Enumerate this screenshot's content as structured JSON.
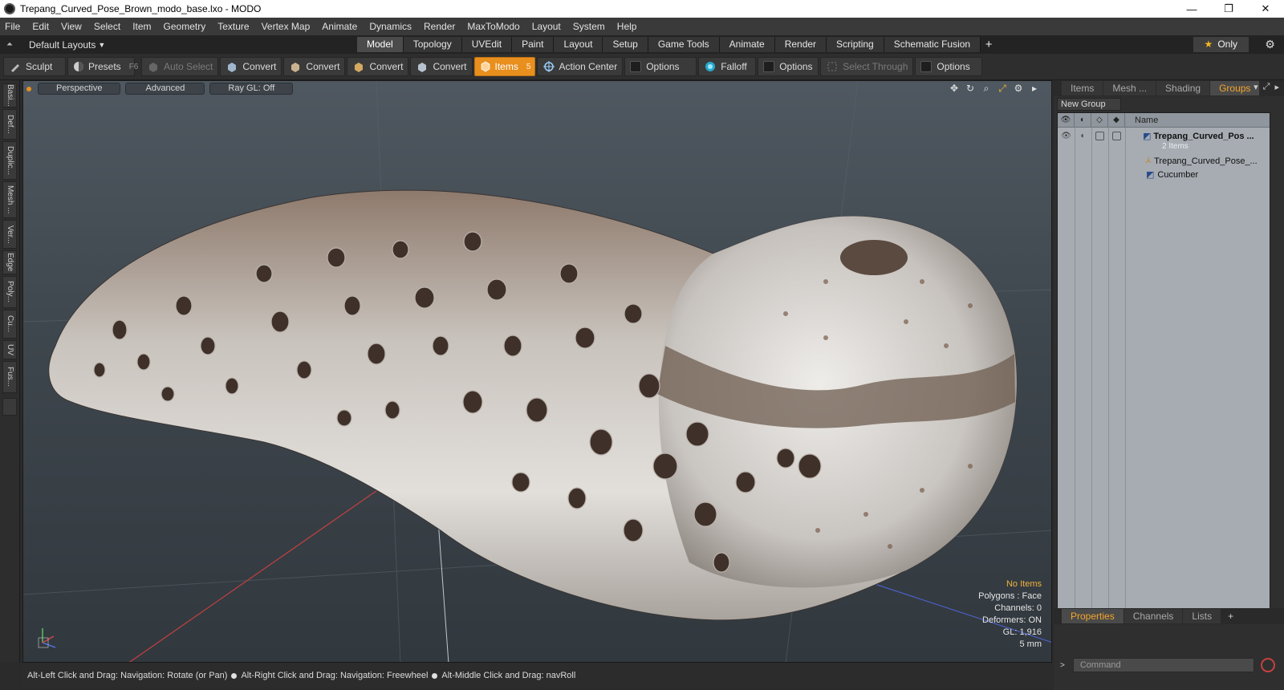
{
  "window": {
    "title": "Trepang_Curved_Pose_Brown_modo_base.lxo - MODO",
    "controls": [
      "—",
      "❐",
      "✕"
    ]
  },
  "menubar": {
    "items": [
      "File",
      "Edit",
      "View",
      "Select",
      "Item",
      "Geometry",
      "Texture",
      "Vertex Map",
      "Animate",
      "Dynamics",
      "Render",
      "MaxToModo",
      "Layout",
      "System",
      "Help"
    ]
  },
  "layoutbar": {
    "layouts_label": "Default Layouts",
    "tabs": [
      "Model",
      "Topology",
      "UVEdit",
      "Paint",
      "Layout",
      "Setup",
      "Game Tools",
      "Animate",
      "Render",
      "Scripting",
      "Schematic Fusion"
    ],
    "active_tab": "Model",
    "add_tab": "+",
    "only_label": "Only"
  },
  "toolbar": {
    "sculpt": "Sculpt",
    "presets": "Presets",
    "presets_key": "F6",
    "auto_select": "Auto Select",
    "convert1": "Convert",
    "convert2": "Convert",
    "convert3": "Convert",
    "convert4": "Convert",
    "items": "Items",
    "items_key": "5",
    "action_center": "Action Center",
    "options1": "Options",
    "falloff": "Falloff",
    "options2": "Options",
    "select_through": "Select Through",
    "options3": "Options"
  },
  "leftstrip": {
    "tabs": [
      "Basi...",
      "Def...",
      "Duplic...",
      "Mesh ...",
      "Ver...",
      "Edge",
      "Poly...",
      "Cu...",
      "UV",
      "Fus..."
    ]
  },
  "viewport": {
    "view_mode": "Perspective",
    "shading": "Advanced",
    "raygl": "Ray GL: Off",
    "stats": {
      "selection": "No Items",
      "polygons": "Polygons : Face",
      "channels": "Channels: 0",
      "deformers": "Deformers: ON",
      "gl": "GL: 1,916",
      "unit": "5 mm"
    },
    "colors": {
      "bg_top": "#4f5860",
      "bg_bottom": "#31383e",
      "body_light": "#d9d7d4",
      "body_dark": "#7b6a5e",
      "spot": "#4a3a30"
    }
  },
  "statusbar": {
    "hint1": "Alt-Left Click and Drag: Navigation: Rotate (or Pan)",
    "hint2": "Alt-Right Click and Drag: Navigation: Freewheel",
    "hint3": "Alt-Middle Click and Drag: navRoll"
  },
  "rightpanel": {
    "tabs": [
      "Items",
      "Mesh ...",
      "Shading",
      "Groups"
    ],
    "active_tab": "Groups",
    "new_group": "New Group",
    "name_header": "Name",
    "group": {
      "name": "Trepang_Curved_Pos ...",
      "count": "2 Items",
      "children": [
        "Trepang_Curved_Pose_...",
        "Cucumber"
      ]
    },
    "bottom_tabs": [
      "Properties",
      "Channels",
      "Lists"
    ],
    "bottom_active": "Properties",
    "command_placeholder": "Command"
  },
  "accent_color": "#e88f1e"
}
